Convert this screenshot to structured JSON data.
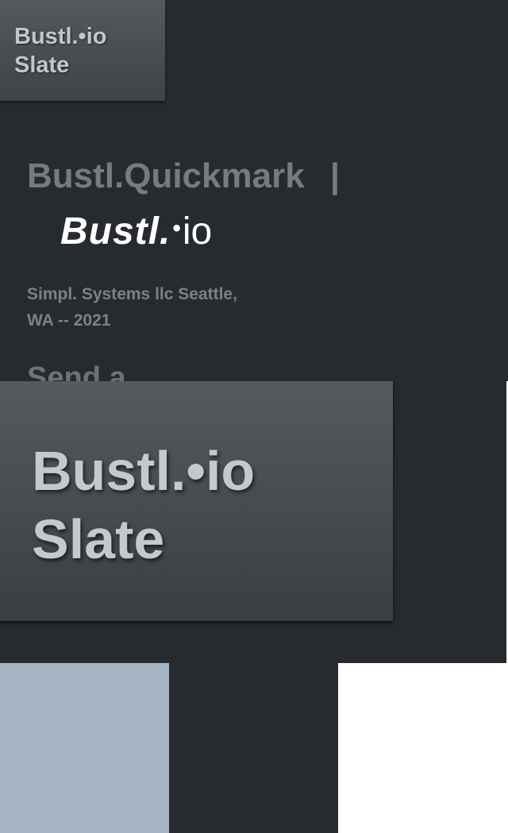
{
  "logo_tile": {
    "line1": "Bustl.•io",
    "line2": "Slate"
  },
  "headline": {
    "product": "Bustl.Quickmark",
    "separator": "|"
  },
  "brand_logo": {
    "word": "Bustl.",
    "dot": "•",
    "suffix": "io"
  },
  "company": {
    "line1": "Simpl. Systems llc Seattle,",
    "line2": "WA -- 2021"
  },
  "send_heading": "Send a",
  "overlay_card": {
    "line1": "Bustl.•io",
    "line2": "Slate"
  },
  "palette": {
    "swatch_1": "#a7b6c4",
    "swatch_2": "#272a2f",
    "swatch_3": "#ffffff"
  }
}
